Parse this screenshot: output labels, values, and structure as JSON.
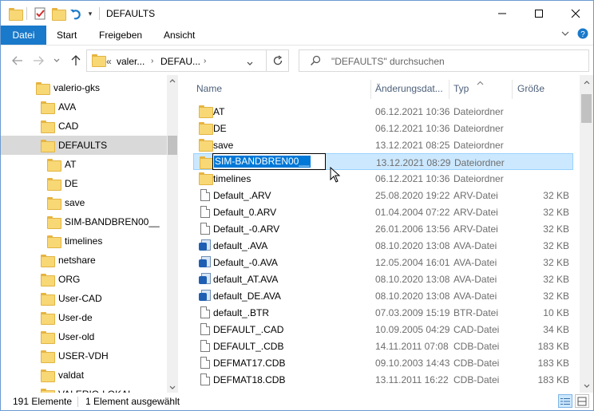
{
  "window": {
    "title": "DEFAULTS"
  },
  "ribbon": {
    "tabs": [
      {
        "label": "Datei"
      },
      {
        "label": "Start"
      },
      {
        "label": "Freigeben"
      },
      {
        "label": "Ansicht"
      }
    ]
  },
  "address": {
    "prefix": "«",
    "crumbs": [
      "valer...",
      "DEFAU..."
    ]
  },
  "search": {
    "placeholder": "\"DEFAULTS\" durchsuchen"
  },
  "nav": {
    "items": [
      {
        "label": "valerio-gks",
        "indent": 0
      },
      {
        "label": "AVA",
        "indent": 1
      },
      {
        "label": "CAD",
        "indent": 1
      },
      {
        "label": "DEFAULTS",
        "indent": 1,
        "selected": true
      },
      {
        "label": "AT",
        "indent": 2
      },
      {
        "label": "DE",
        "indent": 2
      },
      {
        "label": "save",
        "indent": 2
      },
      {
        "label": "SIM-BANDBREN00__",
        "indent": 2
      },
      {
        "label": "timelines",
        "indent": 2
      },
      {
        "label": "netshare",
        "indent": 1
      },
      {
        "label": "ORG",
        "indent": 1
      },
      {
        "label": "User-CAD",
        "indent": 1
      },
      {
        "label": "User-de",
        "indent": 1
      },
      {
        "label": "User-old",
        "indent": 1
      },
      {
        "label": "USER-VDH",
        "indent": 1
      },
      {
        "label": "valdat",
        "indent": 1
      },
      {
        "label": "VALERIO-LOKAL",
        "indent": 1
      }
    ]
  },
  "columns": {
    "name": "Name",
    "date": "Änderungsdat...",
    "type": "Typ",
    "size": "Größe"
  },
  "files": [
    {
      "name": "AT",
      "date": "06.12.2021 10:36",
      "type": "Dateiordner",
      "size": "",
      "icon": "folder"
    },
    {
      "name": "DE",
      "date": "06.12.2021 10:36",
      "type": "Dateiordner",
      "size": "",
      "icon": "folder"
    },
    {
      "name": "save",
      "date": "13.12.2021 08:25",
      "type": "Dateiordner",
      "size": "",
      "icon": "folder"
    },
    {
      "name": "SIM-BANDBREN00__",
      "date": "13.12.2021 08:29",
      "type": "Dateiordner",
      "size": "",
      "icon": "folder",
      "selected": true,
      "renaming": true
    },
    {
      "name": "timelines",
      "date": "06.12.2021 10:36",
      "type": "Dateiordner",
      "size": "",
      "icon": "folder"
    },
    {
      "name": "Default_.ARV",
      "date": "25.08.2020 19:22",
      "type": "ARV-Datei",
      "size": "32 KB",
      "icon": "file"
    },
    {
      "name": "Default_0.ARV",
      "date": "01.04.2004 07:22",
      "type": "ARV-Datei",
      "size": "32 KB",
      "icon": "file"
    },
    {
      "name": "Default_-0.ARV",
      "date": "26.01.2006 13:56",
      "type": "ARV-Datei",
      "size": "32 KB",
      "icon": "file"
    },
    {
      "name": "default_.AVA",
      "date": "08.10.2020 13:08",
      "type": "AVA-Datei",
      "size": "32 KB",
      "icon": "app"
    },
    {
      "name": "Default_-0.AVA",
      "date": "12.05.2004 16:01",
      "type": "AVA-Datei",
      "size": "32 KB",
      "icon": "app"
    },
    {
      "name": "default_AT.AVA",
      "date": "08.10.2020 13:08",
      "type": "AVA-Datei",
      "size": "32 KB",
      "icon": "app"
    },
    {
      "name": "default_DE.AVA",
      "date": "08.10.2020 13:08",
      "type": "AVA-Datei",
      "size": "32 KB",
      "icon": "app"
    },
    {
      "name": "default_.BTR",
      "date": "07.03.2009 15:19",
      "type": "BTR-Datei",
      "size": "10 KB",
      "icon": "file"
    },
    {
      "name": "DEFAULT_.CAD",
      "date": "10.09.2005 04:29",
      "type": "CAD-Datei",
      "size": "34 KB",
      "icon": "file"
    },
    {
      "name": "DEFAULT_.CDB",
      "date": "14.11.2011 07:08",
      "type": "CDB-Datei",
      "size": "183 KB",
      "icon": "file"
    },
    {
      "name": "DEFMAT17.CDB",
      "date": "09.10.2003 14:43",
      "type": "CDB-Datei",
      "size": "183 KB",
      "icon": "file"
    },
    {
      "name": "DEFMAT18.CDB",
      "date": "13.11.2011 16:22",
      "type": "CDB-Datei",
      "size": "183 KB",
      "icon": "file"
    }
  ],
  "status": {
    "count": "191 Elemente",
    "selection": "1 Element ausgewählt"
  },
  "colors": {
    "accent": "#1979ca",
    "selection": "#cce8ff",
    "folder": "#f8d775"
  }
}
